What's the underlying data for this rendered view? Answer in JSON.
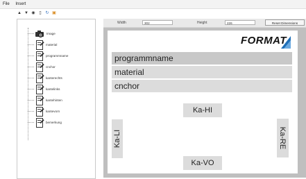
{
  "menubar": {
    "items": [
      "File",
      "Insert"
    ]
  },
  "toolbar": {
    "icons": [
      "arrow-up-icon",
      "arrow-down-icon",
      "eye-icon",
      "trash-icon",
      "refresh-icon",
      "image-icon"
    ]
  },
  "tree": {
    "items": [
      {
        "label": "Image",
        "icon": "camera-icon"
      },
      {
        "label": "material",
        "icon": "document-edit-icon"
      },
      {
        "label": "programmname",
        "icon": "document-edit-icon"
      },
      {
        "label": "cnchor",
        "icon": "document-edit-icon"
      },
      {
        "label": "kanterechts",
        "icon": "document-edit-icon"
      },
      {
        "label": "kantelinks",
        "icon": "document-edit-icon"
      },
      {
        "label": "kantehinten",
        "icon": "document-edit-icon"
      },
      {
        "label": "kantevorn",
        "icon": "document-edit-icon"
      },
      {
        "label": "bemerkung",
        "icon": "document-edit-icon"
      }
    ]
  },
  "dimensions": {
    "width_label": "Width",
    "width_value": "302",
    "height_label": "Height",
    "height_value": "226",
    "reset_label": "Reset Dimensions"
  },
  "canvas": {
    "logo_text": "FORMAT",
    "logo_accent_color": "#1f6fb8",
    "fields": [
      "programmname",
      "material",
      "cnchor"
    ],
    "label_top": "Ka-HI",
    "label_bottom": "Ka-VO",
    "label_left": "Ka-LI",
    "label_right": "Ka-RE"
  }
}
